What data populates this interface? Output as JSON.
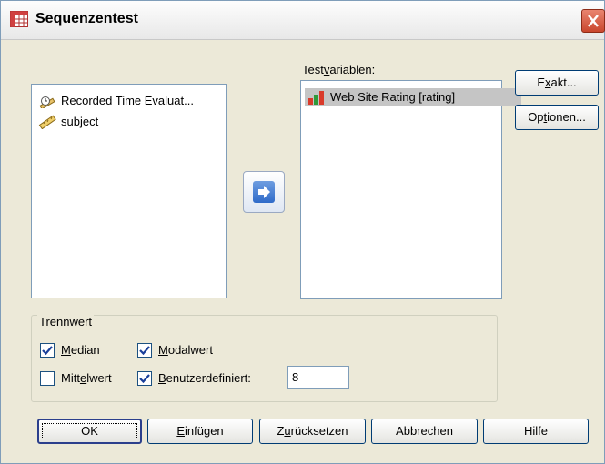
{
  "window": {
    "title": "Sequenzentest",
    "icon": "table-icon",
    "close_icon": "close-icon"
  },
  "source_list": {
    "items": [
      {
        "label": "Recorded Time Evaluat...",
        "icon": "scale-time-icon"
      },
      {
        "label": "subject",
        "icon": "ruler-icon"
      }
    ]
  },
  "move_button": {
    "icon": "arrow-right-icon"
  },
  "test_variables": {
    "label_pre": "Test",
    "label_ul": "v",
    "label_post": "ariablen:",
    "items": [
      {
        "label": "Web Site Rating [rating]",
        "icon": "ordinal-bar-icon",
        "selected": true
      }
    ]
  },
  "side_buttons": {
    "exact_pre": "E",
    "exact_ul": "x",
    "exact_post": "akt...",
    "options_pre": "Op",
    "options_ul": "t",
    "options_post": "ionen..."
  },
  "cutpoint": {
    "legend": "Trennwert",
    "median": {
      "pre": "",
      "ul": "M",
      "post": "edian",
      "checked": true
    },
    "mode": {
      "pre": "",
      "ul": "M",
      "post": "odalwert",
      "checked": true
    },
    "mean": {
      "pre": "Mitt",
      "ul": "e",
      "post": "lwert",
      "checked": false
    },
    "custom": {
      "pre": "",
      "ul": "B",
      "post": "enutzerdefiniert:",
      "checked": true
    },
    "custom_value": "8"
  },
  "footer": {
    "ok": "OK",
    "paste_pre": "",
    "paste_ul": "E",
    "paste_post": "infügen",
    "reset_pre": "Z",
    "reset_ul": "u",
    "reset_post": "rücksetzen",
    "cancel": "Abbrechen",
    "help": "Hilfe"
  }
}
